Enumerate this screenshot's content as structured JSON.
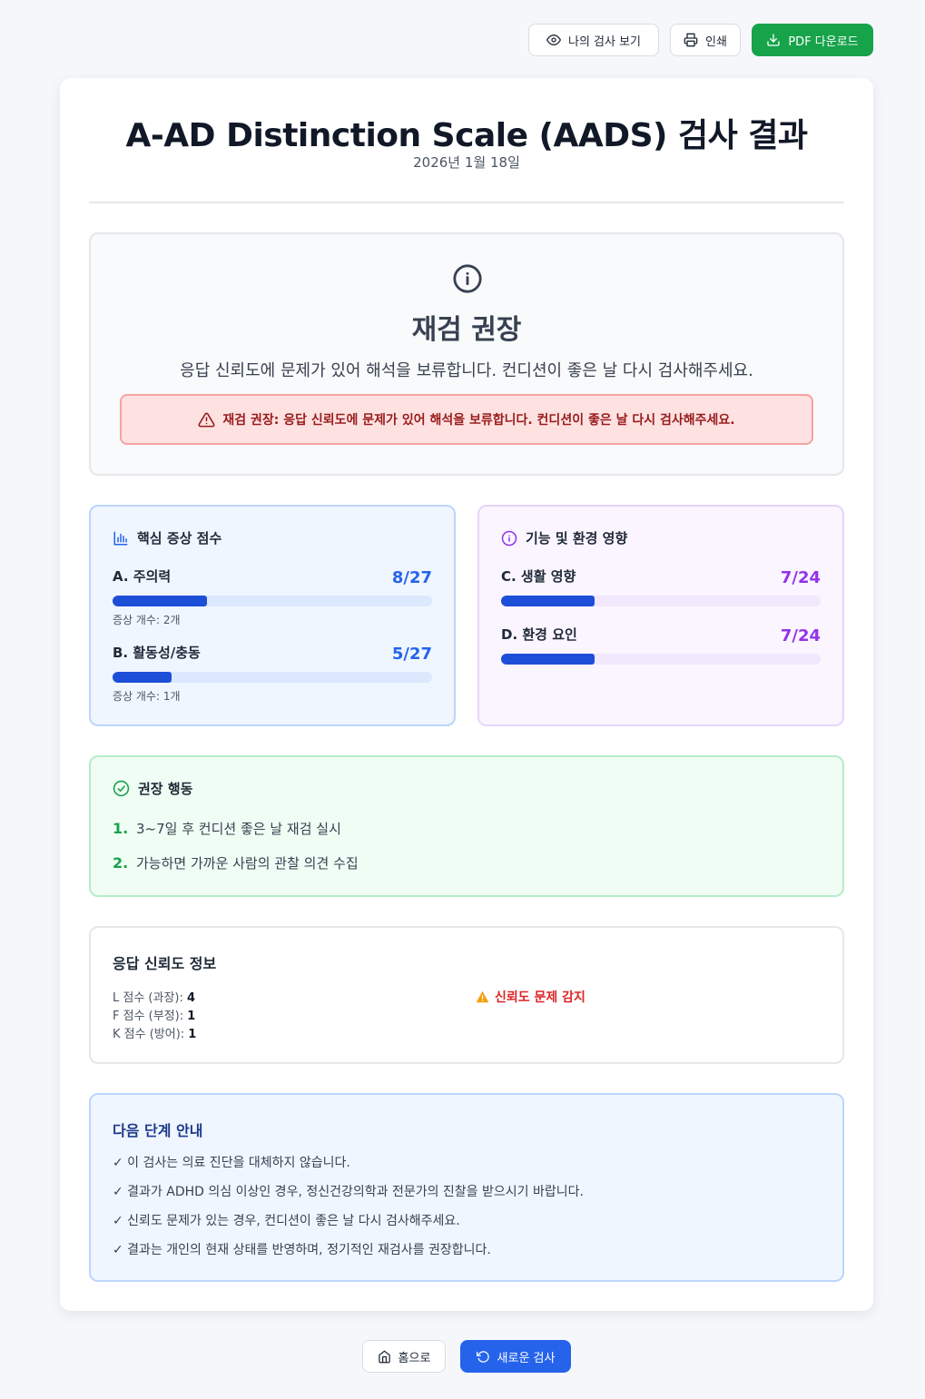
{
  "toolbar": {
    "view_label": "나의 검사 보기",
    "print_label": "인쇄",
    "pdf_label": "PDF 다운로드"
  },
  "header": {
    "title": "A-AD Distinction Scale (AADS) 검사 결과",
    "date": "2026년 1월 18일"
  },
  "verdict": {
    "icon": "info-circle-icon",
    "title": "재검 권장",
    "description": "응답 신뢰도에 문제가 있어 해석을 보류합니다. 컨디션이 좋은 날 다시 검사해주세요.",
    "alert": "재검 권장: 응답 신뢰도에 문제가 있어 해석을 보류합니다. 컨디션이 좋은 날 다시 검사해주세요."
  },
  "core": {
    "title": "핵심 증상 점수",
    "icon": "bar-chart-icon",
    "items": [
      {
        "label": "A. 주의력",
        "score": "8/27",
        "fraction": 0.296,
        "sub": "증상 개수: 2개"
      },
      {
        "label": "B. 활동성/충동",
        "score": "5/27",
        "fraction": 0.185,
        "sub": "증상 개수: 1개"
      }
    ]
  },
  "function": {
    "title": "기능 및 환경 영향",
    "icon": "info-circle-icon",
    "items": [
      {
        "label": "C. 생활 영향",
        "score": "7/24",
        "fraction": 0.292
      },
      {
        "label": "D. 환경 요인",
        "score": "7/24",
        "fraction": 0.292
      }
    ]
  },
  "actions": {
    "title": "권장 행동",
    "icon": "check-circle-icon",
    "items": [
      {
        "num": "1.",
        "text": "3~7일 후 컨디션 좋은 날 재검 실시"
      },
      {
        "num": "2.",
        "text": "가능하면 가까운 사람의 관찰 의견 수집"
      }
    ]
  },
  "reliability": {
    "title": "응답 신뢰도 정보",
    "rows": [
      {
        "label": "L 점수 (과장):",
        "value": "4"
      },
      {
        "label": "F 점수 (부정):",
        "value": "1"
      },
      {
        "label": "K 점수 (방어):",
        "value": "1"
      }
    ],
    "warning": "신뢰도 문제 감지"
  },
  "next_steps": {
    "title": "다음 단계 안내",
    "items": [
      "✓ 이 검사는 의료 진단을 대체하지 않습니다.",
      "✓ 결과가 ADHD 의심 이상인 경우, 정신건강의학과 전문가의 진찰을 받으시기 바랍니다.",
      "✓ 신뢰도 문제가 있는 경우, 컨디션이 좋은 날 다시 검사해주세요.",
      "✓ 결과는 개인의 현재 상태를 반영하며, 정기적인 재검사를 권장합니다."
    ]
  },
  "footer": {
    "home_label": "홈으로",
    "new_test_label": "새로운 검사"
  },
  "colors": {
    "primary_blue": "#2563eb",
    "success_green": "#16a34a",
    "purple": "#9333ea",
    "danger_red": "#dc2626"
  }
}
